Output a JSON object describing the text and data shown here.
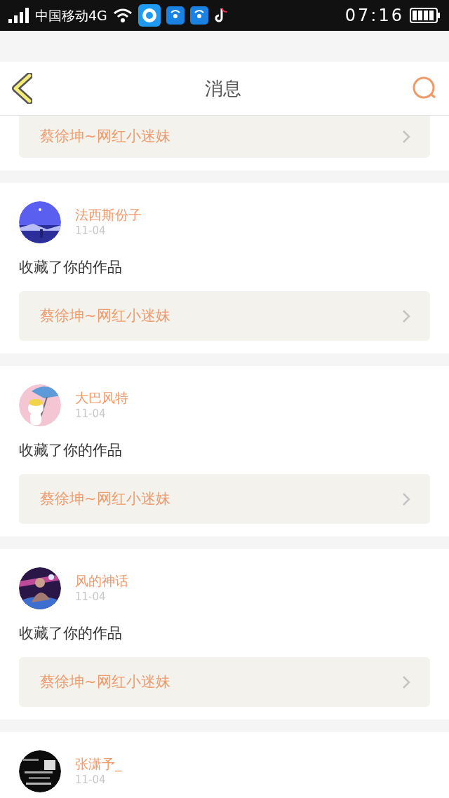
{
  "status_bar": {
    "carrier": "中国移动4G",
    "time": "07:16"
  },
  "header": {
    "title": "消息"
  },
  "messages": [
    {
      "work": "蔡徐坤~网红小迷妹"
    },
    {
      "user": "法西斯份子",
      "date": "11-04",
      "action": "收藏了你的作品",
      "work": "蔡徐坤~网红小迷妹"
    },
    {
      "user": "大巴风特",
      "date": "11-04",
      "action": "收藏了你的作品",
      "work": "蔡徐坤~网红小迷妹"
    },
    {
      "user": "风的神话",
      "date": "11-04",
      "action": "收藏了你的作品",
      "work": "蔡徐坤~网红小迷妹"
    },
    {
      "user": "张潇予_",
      "date": "11-04"
    }
  ]
}
